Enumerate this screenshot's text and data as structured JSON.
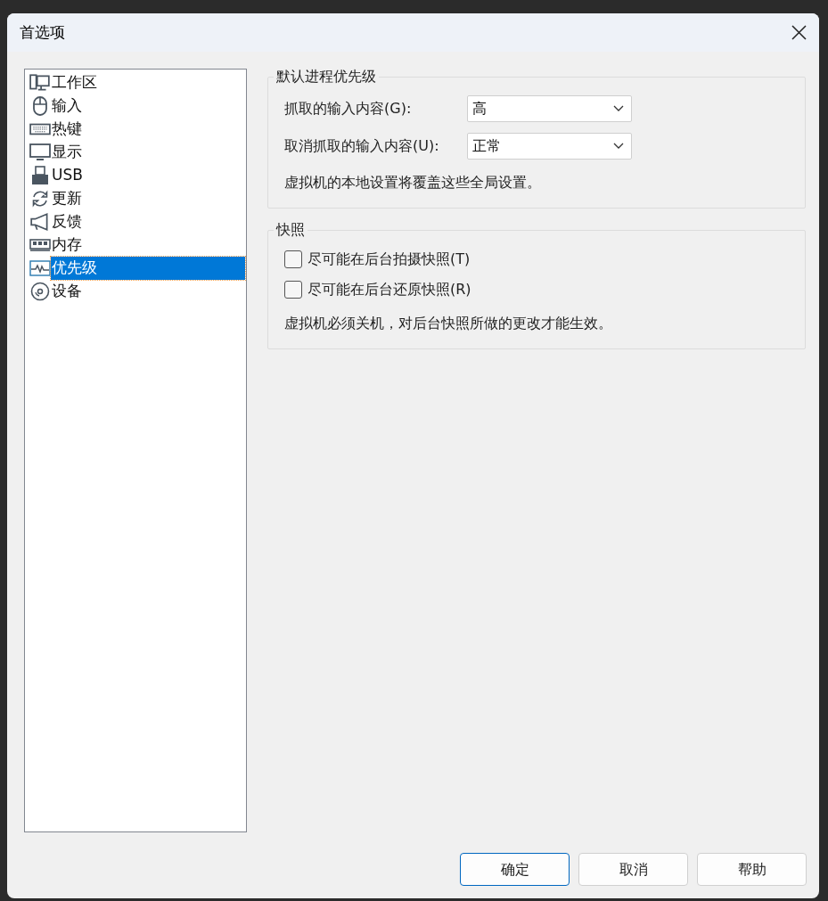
{
  "window": {
    "title": "首选项"
  },
  "sidebar": {
    "items": [
      {
        "label": "工作区",
        "selected": false
      },
      {
        "label": "输入",
        "selected": false
      },
      {
        "label": "热键",
        "selected": false
      },
      {
        "label": "显示",
        "selected": false
      },
      {
        "label": "USB",
        "selected": false
      },
      {
        "label": "更新",
        "selected": false
      },
      {
        "label": "反馈",
        "selected": false
      },
      {
        "label": "内存",
        "selected": false
      },
      {
        "label": "优先级",
        "selected": true
      },
      {
        "label": "设备",
        "selected": false
      }
    ]
  },
  "priority_group": {
    "title": "默认进程优先级",
    "fields": [
      {
        "label": "抓取的输入内容(G):",
        "value": "高"
      },
      {
        "label": "取消抓取的输入内容(U):",
        "value": "正常"
      }
    ],
    "note": "虚拟机的本地设置将覆盖这些全局设置。"
  },
  "snapshot_group": {
    "title": "快照",
    "options": [
      {
        "label": "尽可能在后台拍摄快照(T)",
        "checked": false
      },
      {
        "label": "尽可能在后台还原快照(R)",
        "checked": false
      }
    ],
    "note": "虚拟机必须关机，对后台快照所做的更改才能生效。"
  },
  "buttons": [
    {
      "label": "确定",
      "kind": "default"
    },
    {
      "label": "取消",
      "kind": "normal"
    },
    {
      "label": "帮助",
      "kind": "normal"
    }
  ]
}
